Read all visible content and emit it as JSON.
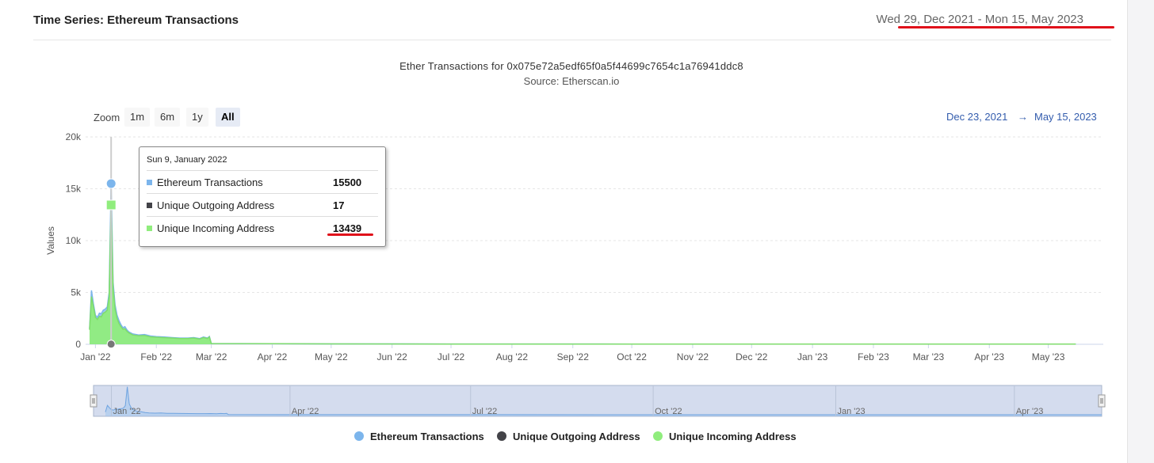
{
  "panel": {
    "title": "Time Series: Ethereum Transactions",
    "date_range": "Wed 29, Dec 2021 - Mon 15, May 2023"
  },
  "controls": {
    "zoom_label": "Zoom",
    "zoom_buttons": [
      "1m",
      "6m",
      "1y",
      "All"
    ],
    "active_zoom": "All",
    "range_from": "Dec 23, 2021",
    "range_arrow": "→",
    "range_to": "May 15, 2023"
  },
  "tooltip": {
    "date": "Sun 9, January 2022",
    "rows": [
      {
        "name": "Ethereum Transactions",
        "value": "15500",
        "color": "#7cb5ec"
      },
      {
        "name": "Unique Outgoing Address",
        "value": "17",
        "color": "#434348"
      },
      {
        "name": "Unique Incoming Address",
        "value": "13439",
        "color": "#90ed7d"
      }
    ]
  },
  "chart_data": {
    "type": "area",
    "title": "Ether Transactions for 0x075e72a5edf65f0a5f44699c7654c1a76941ddc8",
    "subtitle": "Source: Etherscan.io",
    "ylabel": "Values",
    "ylim": [
      0,
      20000
    ],
    "yticks": [
      0,
      5000,
      10000,
      15000,
      20000
    ],
    "ytick_labels": [
      "0",
      "5k",
      "10k",
      "15k",
      "20k"
    ],
    "xlim": [
      "2021-12-27",
      "2023-05-29"
    ],
    "xticks": [
      {
        "date": "2022-01-01",
        "label": "Jan '22"
      },
      {
        "date": "2022-02-01",
        "label": "Feb '22"
      },
      {
        "date": "2022-03-01",
        "label": "Mar '22"
      },
      {
        "date": "2022-04-01",
        "label": "Apr '22"
      },
      {
        "date": "2022-05-01",
        "label": "May '22"
      },
      {
        "date": "2022-06-01",
        "label": "Jun '22"
      },
      {
        "date": "2022-07-01",
        "label": "Jul '22"
      },
      {
        "date": "2022-08-01",
        "label": "Aug '22"
      },
      {
        "date": "2022-09-01",
        "label": "Sep '22"
      },
      {
        "date": "2022-10-01",
        "label": "Oct '22"
      },
      {
        "date": "2022-11-01",
        "label": "Nov '22"
      },
      {
        "date": "2022-12-01",
        "label": "Dec '22"
      },
      {
        "date": "2023-01-01",
        "label": "Jan '23"
      },
      {
        "date": "2023-02-01",
        "label": "Feb '23"
      },
      {
        "date": "2023-03-01",
        "label": "Mar '23"
      },
      {
        "date": "2023-04-01",
        "label": "Apr '23"
      },
      {
        "date": "2023-05-01",
        "label": "May '23"
      }
    ],
    "navigator_xlim": [
      "2021-12-23",
      "2023-05-15"
    ],
    "navigator_ticks": [
      {
        "date": "2022-01-01",
        "label": "Jan '22"
      },
      {
        "date": "2022-04-01",
        "label": "Apr '22"
      },
      {
        "date": "2022-07-01",
        "label": "Jul '22"
      },
      {
        "date": "2022-10-01",
        "label": "Oct '22"
      },
      {
        "date": "2023-01-01",
        "label": "Jan '23"
      },
      {
        "date": "2023-04-01",
        "label": "Apr '23"
      }
    ],
    "grid": true,
    "legend_position": "bottom-center",
    "series": [
      {
        "name": "Ethereum Transactions",
        "color": "#7cb5ec",
        "points": [
          [
            "2021-12-29",
            1500
          ],
          [
            "2021-12-30",
            5200
          ],
          [
            "2021-12-31",
            3900
          ],
          [
            "2022-01-01",
            2800
          ],
          [
            "2022-01-02",
            2600
          ],
          [
            "2022-01-03",
            3000
          ],
          [
            "2022-01-04",
            2950
          ],
          [
            "2022-01-05",
            3300
          ],
          [
            "2022-01-06",
            3400
          ],
          [
            "2022-01-07",
            3600
          ],
          [
            "2022-01-08",
            5000
          ],
          [
            "2022-01-09",
            15500
          ],
          [
            "2022-01-10",
            6000
          ],
          [
            "2022-01-11",
            3800
          ],
          [
            "2022-01-12",
            2800
          ],
          [
            "2022-01-13",
            2300
          ],
          [
            "2022-01-14",
            1900
          ],
          [
            "2022-01-15",
            1600
          ],
          [
            "2022-01-16",
            1700
          ],
          [
            "2022-01-17",
            1400
          ],
          [
            "2022-01-18",
            1200
          ],
          [
            "2022-01-20",
            1000
          ],
          [
            "2022-01-23",
            900
          ],
          [
            "2022-01-26",
            950
          ],
          [
            "2022-01-29",
            800
          ],
          [
            "2022-02-01",
            750
          ],
          [
            "2022-02-05",
            700
          ],
          [
            "2022-02-09",
            650
          ],
          [
            "2022-02-13",
            600
          ],
          [
            "2022-02-17",
            600
          ],
          [
            "2022-02-20",
            650
          ],
          [
            "2022-02-23",
            550
          ],
          [
            "2022-02-25",
            700
          ],
          [
            "2022-02-27",
            600
          ],
          [
            "2022-02-28",
            750
          ],
          [
            "2022-03-01",
            80
          ],
          [
            "2022-04-01",
            60
          ],
          [
            "2022-05-01",
            40
          ],
          [
            "2022-07-01",
            30
          ],
          [
            "2022-10-01",
            20
          ],
          [
            "2023-01-01",
            20
          ],
          [
            "2023-05-15",
            20
          ]
        ]
      },
      {
        "name": "Unique Outgoing Address",
        "color": "#434348",
        "points": [
          [
            "2021-12-29",
            5
          ],
          [
            "2022-01-09",
            17
          ],
          [
            "2022-03-01",
            5
          ],
          [
            "2023-05-15",
            2
          ]
        ]
      },
      {
        "name": "Unique Incoming Address",
        "color": "#90ed7d",
        "points": [
          [
            "2021-12-29",
            1400
          ],
          [
            "2021-12-30",
            4600
          ],
          [
            "2021-12-31",
            3600
          ],
          [
            "2022-01-01",
            2600
          ],
          [
            "2022-01-02",
            2400
          ],
          [
            "2022-01-03",
            2700
          ],
          [
            "2022-01-04",
            2650
          ],
          [
            "2022-01-05",
            3000
          ],
          [
            "2022-01-06",
            3100
          ],
          [
            "2022-01-07",
            3300
          ],
          [
            "2022-01-08",
            4600
          ],
          [
            "2022-01-09",
            13439
          ],
          [
            "2022-01-10",
            5400
          ],
          [
            "2022-01-11",
            3400
          ],
          [
            "2022-01-12",
            2500
          ],
          [
            "2022-01-13",
            2000
          ],
          [
            "2022-01-14",
            1700
          ],
          [
            "2022-01-15",
            1450
          ],
          [
            "2022-01-16",
            1500
          ],
          [
            "2022-01-17",
            1250
          ],
          [
            "2022-01-18",
            1100
          ],
          [
            "2022-01-20",
            900
          ],
          [
            "2022-01-23",
            820
          ],
          [
            "2022-01-26",
            850
          ],
          [
            "2022-01-29",
            720
          ],
          [
            "2022-02-01",
            680
          ],
          [
            "2022-02-05",
            640
          ],
          [
            "2022-02-09",
            600
          ],
          [
            "2022-02-13",
            560
          ],
          [
            "2022-02-17",
            560
          ],
          [
            "2022-02-20",
            600
          ],
          [
            "2022-02-23",
            500
          ],
          [
            "2022-02-25",
            650
          ],
          [
            "2022-02-27",
            560
          ],
          [
            "2022-02-28",
            700
          ],
          [
            "2022-03-01",
            70
          ],
          [
            "2022-04-01",
            50
          ],
          [
            "2022-05-01",
            35
          ],
          [
            "2022-07-01",
            25
          ],
          [
            "2022-10-01",
            18
          ],
          [
            "2023-01-01",
            18
          ],
          [
            "2023-05-15",
            18
          ]
        ]
      }
    ],
    "highlight": {
      "date": "2022-01-09"
    }
  }
}
